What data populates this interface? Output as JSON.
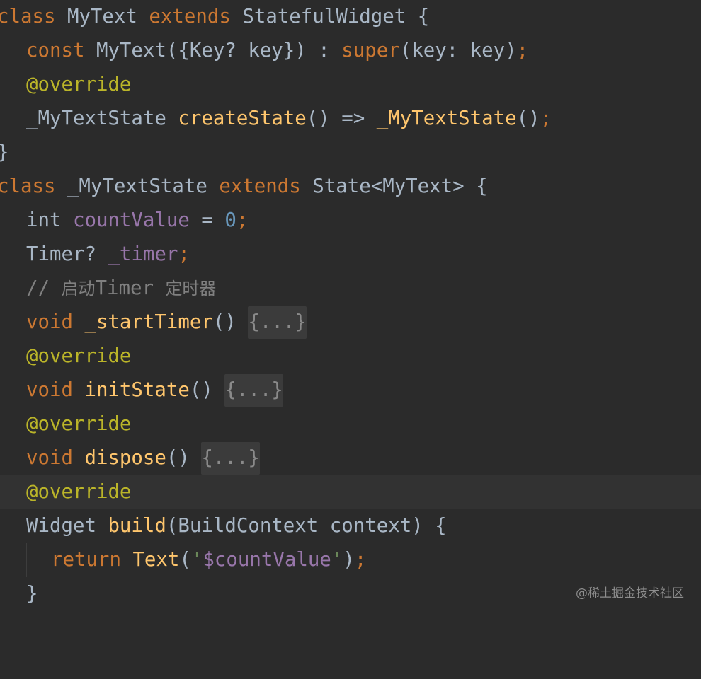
{
  "code_lines": [
    {
      "text": "class MyText extends StatefulWidget {"
    },
    {
      "text": "  const MyText({Key? key}) : super(key: key);"
    },
    {
      "text": "  @override"
    },
    {
      "text": "  _MyTextState createState() => _MyTextState();"
    },
    {
      "text": "}"
    },
    {
      "text": "class _MyTextState extends State<MyText> {"
    },
    {
      "text": "  int countValue = 0;"
    },
    {
      "text": "  Timer? _timer;"
    },
    {
      "text": "  // 启动Timer 定时器"
    },
    {
      "text": "  void _startTimer() {...}"
    },
    {
      "text": "  @override"
    },
    {
      "text": "  void initState() {...}"
    },
    {
      "text": "  @override"
    },
    {
      "text": "  void dispose() {...}"
    },
    {
      "text": "  @override"
    },
    {
      "text": "  Widget build(BuildContext context) {"
    },
    {
      "text": "    return Text('$countValue');"
    },
    {
      "text": "  }"
    }
  ],
  "tokens": {
    "l1": [
      "class",
      "MyText",
      "extends",
      "StatefulWidget",
      "{"
    ],
    "l2": [
      "const",
      "MyText({Key? key}) : ",
      "super",
      "(key: key)",
      ";"
    ],
    "l3": [
      "@",
      "override"
    ],
    "l4": [
      "_MyTextState ",
      "createState",
      "() => ",
      "_MyTextState",
      "()",
      ";"
    ],
    "l5": [
      "}"
    ],
    "l6": [
      "class",
      " _MyTextState ",
      "extends",
      " State<MyText> {"
    ],
    "l7": [
      "int ",
      "countValue",
      " = ",
      "0",
      ";"
    ],
    "l8": [
      "Timer? ",
      "_timer",
      ";"
    ],
    "l9": [
      "// ",
      "启动",
      "Timer ",
      "定时器"
    ],
    "l10": [
      "void ",
      "_startTimer",
      "() ",
      "{...}"
    ],
    "l11": [
      "@",
      "override"
    ],
    "l12": [
      "void ",
      "initState",
      "() ",
      "{...}"
    ],
    "l13": [
      "@",
      "override"
    ],
    "l14": [
      "void ",
      "dispose",
      "() ",
      "{...}"
    ],
    "l15": [
      "@",
      "override"
    ],
    "l16": [
      "Widget ",
      "build",
      "(BuildContext context) {"
    ],
    "l17": [
      "return ",
      "Text",
      "(",
      "'",
      "$countValue",
      "'",
      ")",
      ";"
    ],
    "l18": [
      "}"
    ]
  },
  "watermark": "@稀土掘金技术社区",
  "colors": {
    "background": "#2b2b2b",
    "current_line": "#323232",
    "keyword": "#cc7832",
    "function": "#ffc66d",
    "field": "#9876aa",
    "number": "#6897bb",
    "string": "#6a8759",
    "comment": "#808080",
    "annotation": "#bbb529",
    "text": "#a9b7c6",
    "fold": "#3b3b3b"
  }
}
